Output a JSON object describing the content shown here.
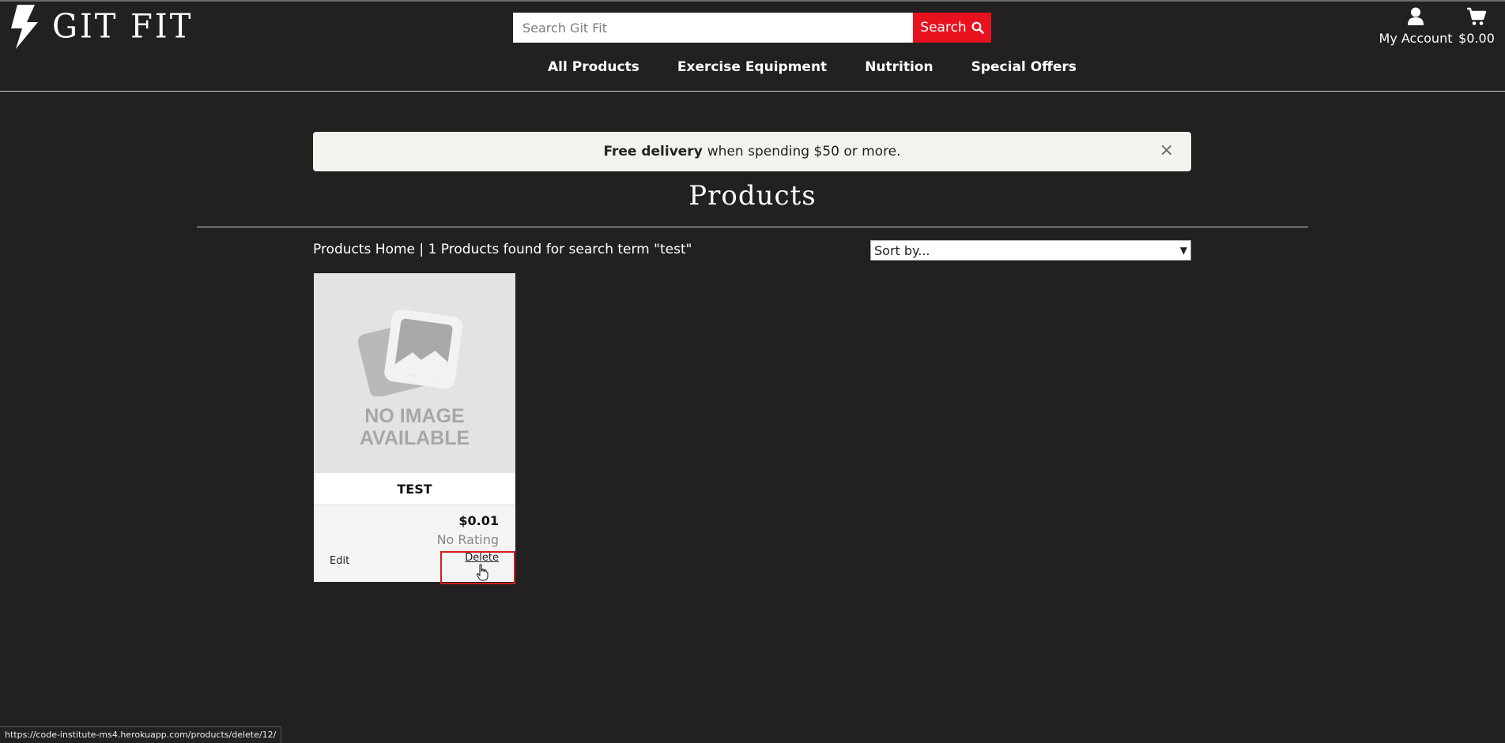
{
  "brand": {
    "name": "GIT FIT"
  },
  "search": {
    "placeholder": "Search Git Fit",
    "value": "",
    "button_label": "Search"
  },
  "header": {
    "account_label": "My Account",
    "cart_total": "$0.00"
  },
  "nav": {
    "items": [
      "All Products",
      "Exercise Equipment",
      "Nutrition",
      "Special Offers"
    ]
  },
  "banner": {
    "bold": "Free delivery",
    "text": "when spending $50 or more.",
    "close": "×"
  },
  "page": {
    "title": "Products"
  },
  "results": {
    "home_link": "Products Home",
    "separator": "|",
    "summary": "1 Products found for search term \"test\""
  },
  "sort": {
    "selected": "Sort by..."
  },
  "products": [
    {
      "image_text": "NO IMAGE\nAVAILABLE",
      "name": "TEST",
      "price": "$0.01",
      "rating": "No Rating",
      "edit_label": "Edit",
      "delete_label": "Delete"
    }
  ],
  "status_url": "https://code-institute-ms4.herokuapp.com/products/delete/12/",
  "colors": {
    "accent": "#e8121e",
    "background": "#222020",
    "banner_bg": "#f3f3ee",
    "highlight": "#d0201e"
  },
  "icons": [
    "lightning-bolt-icon",
    "search-icon",
    "user-icon",
    "cart-icon",
    "close-icon",
    "image-placeholder-icon",
    "pointer-cursor-icon"
  ]
}
